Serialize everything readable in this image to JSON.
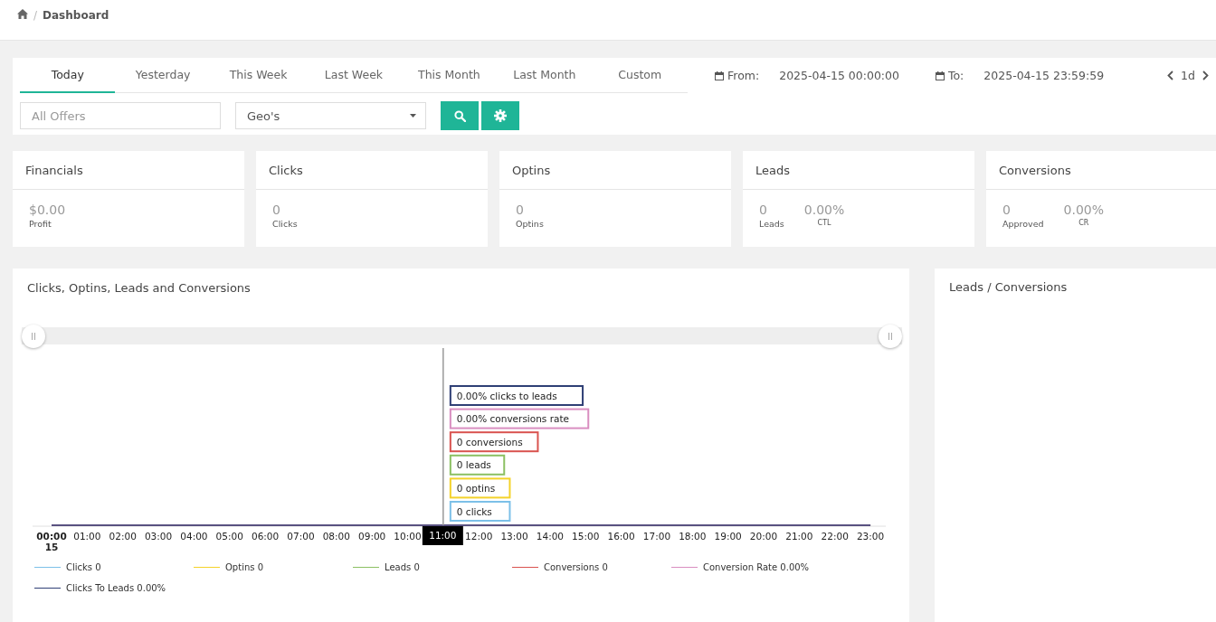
{
  "breadcrumb": {
    "separator": "/",
    "current": "Dashboard"
  },
  "filters": {
    "tabs": [
      {
        "label": "Today",
        "selected": true
      },
      {
        "label": "Yesterday",
        "selected": false
      },
      {
        "label": "This Week",
        "selected": false
      },
      {
        "label": "Last Week",
        "selected": false
      },
      {
        "label": "This Month",
        "selected": false
      },
      {
        "label": "Last Month",
        "selected": false
      },
      {
        "label": "Custom",
        "selected": false
      }
    ],
    "from_label": "From:",
    "from_value": "2025-04-15 00:00:00",
    "to_label": "To:",
    "to_value": "2025-04-15 23:59:59",
    "period": "1d",
    "offers_placeholder": "All Offers",
    "geo_select": "Geo's"
  },
  "stats": [
    {
      "title": "Financials",
      "metrics": [
        {
          "value": "$0.00",
          "label": "Profit"
        }
      ]
    },
    {
      "title": "Clicks",
      "metrics": [
        {
          "value": "0",
          "label": "Clicks"
        }
      ]
    },
    {
      "title": "Optins",
      "metrics": [
        {
          "value": "0",
          "label": "Optins"
        }
      ]
    },
    {
      "title": "Leads",
      "metrics": [
        {
          "value": "0",
          "label": "Leads"
        },
        {
          "value": "0.00%",
          "label": "CTL"
        }
      ]
    },
    {
      "title": "Conversions",
      "metrics": [
        {
          "value": "0",
          "label": "Approved"
        },
        {
          "value": "0.00%",
          "label": "CR"
        }
      ]
    }
  ],
  "main_chart": {
    "title": "Clicks, Optins, Leads and Conversions",
    "range_slider": {
      "level": 1
    },
    "date_label": "15",
    "x_labels": [
      {
        "label": "00:00",
        "kind": "first"
      },
      {
        "label": "01:00",
        "kind": "plain"
      },
      {
        "label": "02:00",
        "kind": "plain"
      },
      {
        "label": "03:00",
        "kind": "plain"
      },
      {
        "label": "04:00",
        "kind": "plain"
      },
      {
        "label": "05:00",
        "kind": "plain"
      },
      {
        "label": "06:00",
        "kind": "plain"
      },
      {
        "label": "07:00",
        "kind": "plain"
      },
      {
        "label": "08:00",
        "kind": "plain"
      },
      {
        "label": "09:00",
        "kind": "plain"
      },
      {
        "label": "10:00",
        "kind": "plain"
      },
      {
        "label": "11:00",
        "kind": "hover"
      },
      {
        "label": "12:00",
        "kind": "plain"
      },
      {
        "label": "13:00",
        "kind": "plain"
      },
      {
        "label": "14:00",
        "kind": "plain"
      },
      {
        "label": "15:00",
        "kind": "plain"
      },
      {
        "label": "16:00",
        "kind": "plain"
      },
      {
        "label": "17:00",
        "kind": "plain"
      },
      {
        "label": "18:00",
        "kind": "plain"
      },
      {
        "label": "19:00",
        "kind": "plain"
      },
      {
        "label": "20:00",
        "kind": "plain"
      },
      {
        "label": "21:00",
        "kind": "plain"
      },
      {
        "label": "22:00",
        "kind": "plain"
      },
      {
        "label": "23:00",
        "kind": "plain"
      }
    ],
    "series": [
      {
        "name": "Clicks",
        "color": "#7cc0e8",
        "legend_value": "0"
      },
      {
        "name": "Optins",
        "color": "#f4d22a",
        "legend_value": "0"
      },
      {
        "name": "Leads",
        "color": "#8cc063",
        "legend_value": "0"
      },
      {
        "name": "Conversions",
        "color": "#d9534f",
        "legend_value": "0"
      },
      {
        "name": "Conversion Rate",
        "color": "#d98ec0",
        "legend_value": "0.00%"
      },
      {
        "name": "Clicks To Leads",
        "color": "#2f3f75",
        "legend_value": "0.00%"
      }
    ],
    "tooltips": [
      {
        "text": "0.00% clicks to leads",
        "color": "#2f3f75"
      },
      {
        "text": "0.00% conversions rate",
        "color": "#d98ec0"
      },
      {
        "text": "0 conversions",
        "color": "#d9534f"
      },
      {
        "text": "0 leads",
        "color": "#8cc063"
      },
      {
        "text": "0 optins",
        "color": "#f4d22a"
      },
      {
        "text": "0 clicks",
        "color": "#7cc0e8"
      }
    ]
  },
  "side_panel": {
    "title": "Leads / Conversions"
  }
}
